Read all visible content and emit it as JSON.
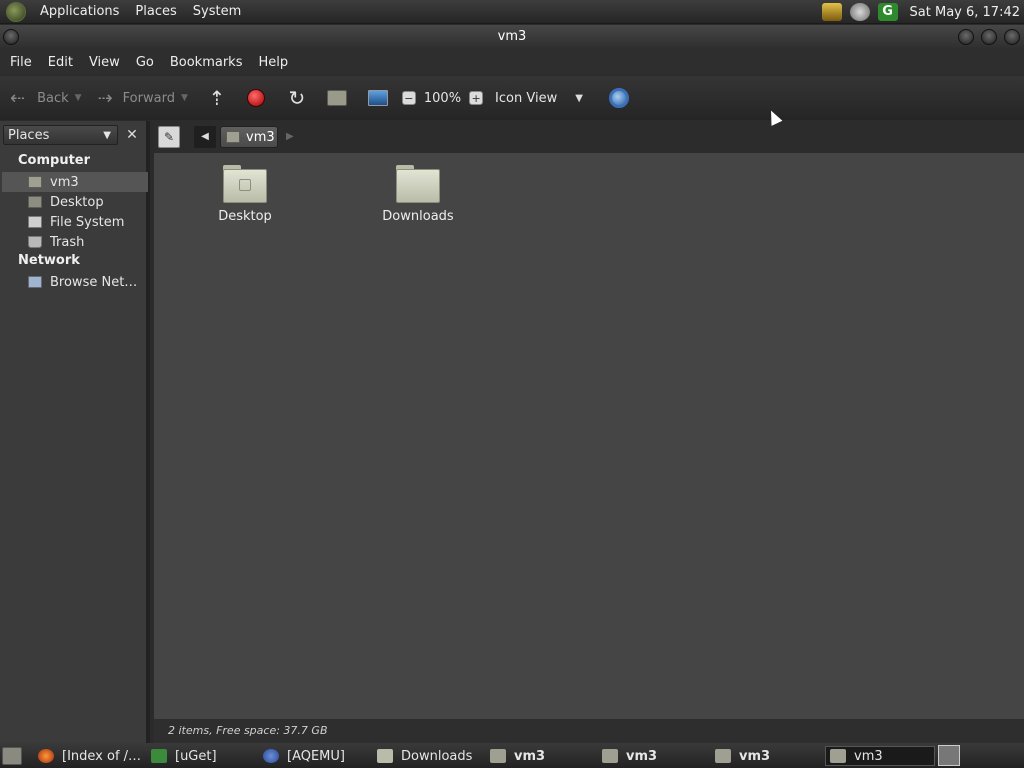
{
  "top_panel": {
    "menus": [
      "Applications",
      "Places",
      "System"
    ],
    "clock": "Sat May  6, 17:42",
    "tray_icons": [
      "bee-icon",
      "volume-icon",
      "uget-icon"
    ]
  },
  "window": {
    "title": "vm3"
  },
  "menubar": [
    "File",
    "Edit",
    "View",
    "Go",
    "Bookmarks",
    "Help"
  ],
  "toolbar": {
    "back_label": "Back",
    "forward_label": "Forward",
    "zoom_level": "100%",
    "view_mode": "Icon View"
  },
  "sidebar": {
    "header": "Places",
    "sections": [
      {
        "title": "Computer",
        "items": [
          {
            "label": "vm3",
            "icon": "home-icon",
            "selected": true
          },
          {
            "label": "Desktop",
            "icon": "desktop-icon",
            "selected": false
          },
          {
            "label": "File System",
            "icon": "drive-icon",
            "selected": false
          },
          {
            "label": "Trash",
            "icon": "trash-icon",
            "selected": false
          }
        ]
      },
      {
        "title": "Network",
        "items": [
          {
            "label": "Browse Net…",
            "icon": "network-icon",
            "selected": false
          }
        ]
      }
    ]
  },
  "location": {
    "crumb": "vm3"
  },
  "files": [
    {
      "name": "Desktop",
      "icon": "folder-desktop-icon"
    },
    {
      "name": "Downloads",
      "icon": "folder-icon"
    }
  ],
  "status": "2 items, Free space: 37.7 GB",
  "taskbar": {
    "tasks": [
      "[Index of /…",
      "[uGet]",
      "[AQEMU]",
      "Downloads",
      "vm3",
      "vm3",
      "vm3",
      "vm3"
    ]
  },
  "colors": {
    "background": "#454545",
    "selection": "#555555",
    "accent_stop": "#cc0000"
  }
}
